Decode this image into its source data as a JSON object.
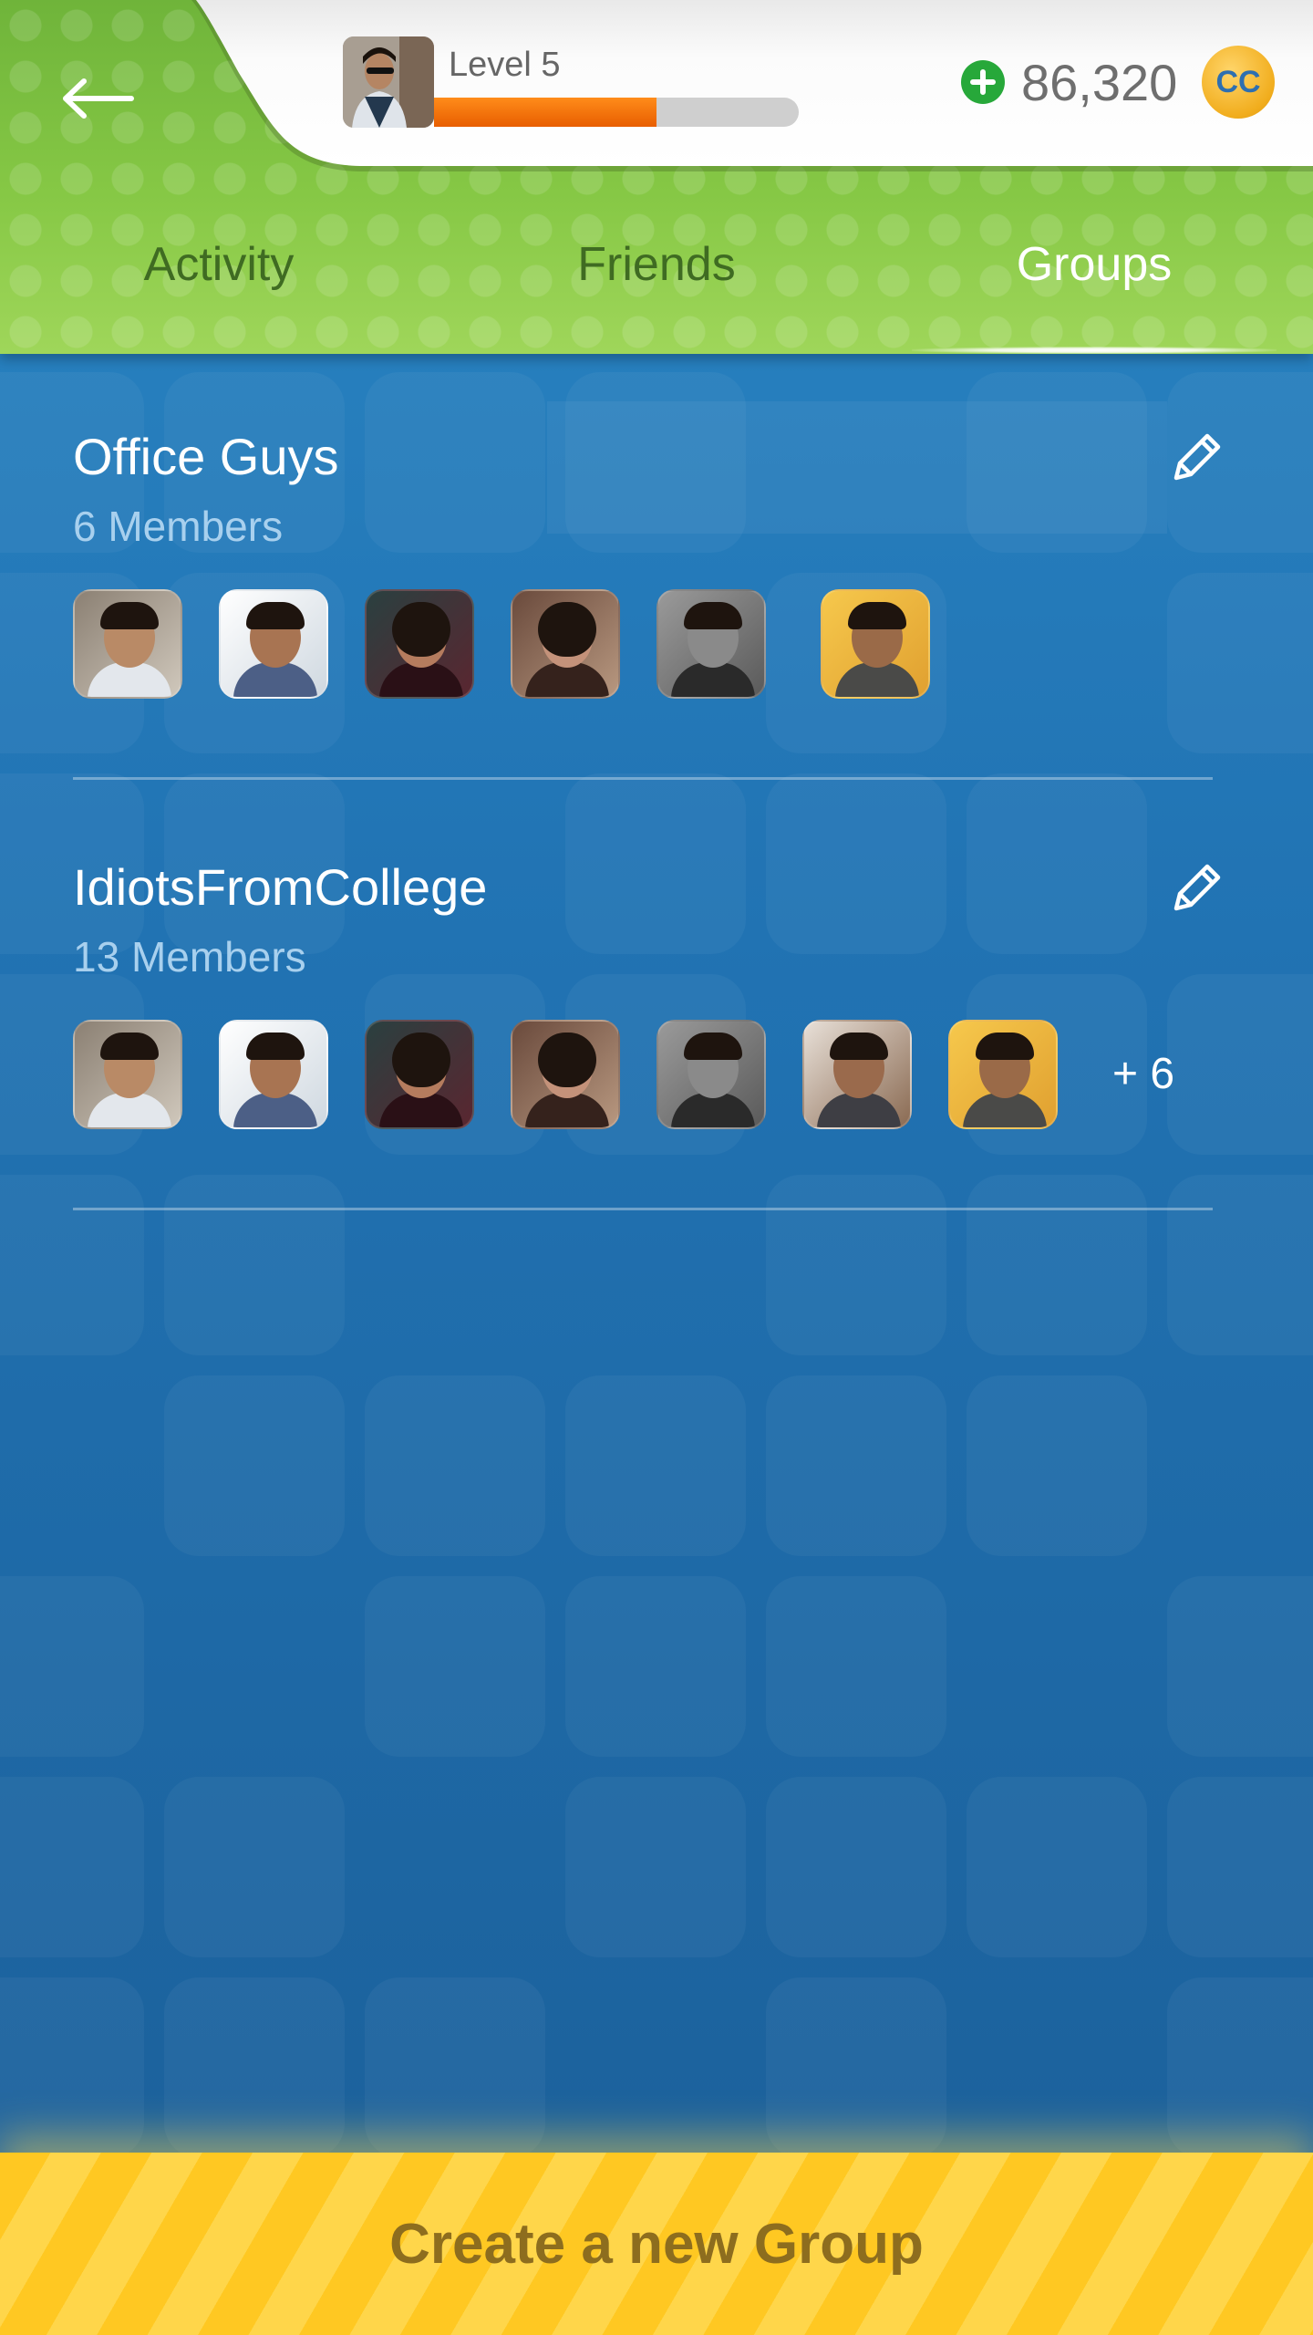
{
  "header": {
    "back_icon": "back-arrow-icon",
    "level_label": "Level 5",
    "level_progress": 0.61,
    "coins": "86,320",
    "coin_icon_label": "CC",
    "add_coins_icon": "plus-circle-icon"
  },
  "tabs": [
    {
      "label": "Activity",
      "active": false
    },
    {
      "label": "Friends",
      "active": false
    },
    {
      "label": "Groups",
      "active": true
    }
  ],
  "groups": [
    {
      "name": "Office Guys",
      "members_label": "6 Members",
      "member_avatars": 6,
      "more_label": ""
    },
    {
      "name": "IdiotsFromCollege",
      "members_label": "13 Members",
      "member_avatars": 7,
      "more_label": "+ 6"
    }
  ],
  "footer": {
    "create_label": "Create a new Group"
  },
  "colors": {
    "header_green": "#86c845",
    "background_blue": "#2173b3",
    "progress_orange": "#f07010",
    "button_yellow": "#ffc822",
    "button_text": "#8d6d1e"
  }
}
